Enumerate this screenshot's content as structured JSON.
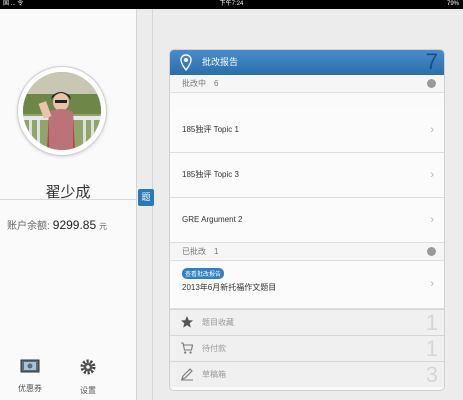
{
  "status_bar": {
    "left": "国 ... 令",
    "time": "下午7:24",
    "battery": "79%"
  },
  "sidebar": {
    "username": "翟少成",
    "balance_label": "账户余额:",
    "balance_value": "9299.85",
    "balance_unit": "元",
    "buttons": [
      {
        "label": "优惠券",
        "icon": "coupon-icon"
      },
      {
        "label": "设置",
        "icon": "gear-icon"
      }
    ]
  },
  "handle_label": "题",
  "panel": {
    "title": "批改报告",
    "count": "7",
    "sections": {
      "in_progress": {
        "label": "批改中",
        "count": "6"
      },
      "done": {
        "label": "已批改",
        "count": "1"
      }
    },
    "in_progress_items": [
      "185独评 Topic 1",
      "185独评 Topic 3",
      "GRE Argument 2"
    ],
    "done_item": {
      "tag": "查看批改报告",
      "title": "2013年6月新托福作文题目"
    },
    "footer_items": [
      {
        "label": "题目收藏",
        "count": "1",
        "icon": "star-icon"
      },
      {
        "label": "待付款",
        "count": "1",
        "icon": "cart-icon"
      },
      {
        "label": "草稿箱",
        "count": "3",
        "icon": "pencil-icon"
      }
    ]
  },
  "colors": {
    "accent": "#2a6eaa",
    "header_count": "#1a4e82"
  }
}
